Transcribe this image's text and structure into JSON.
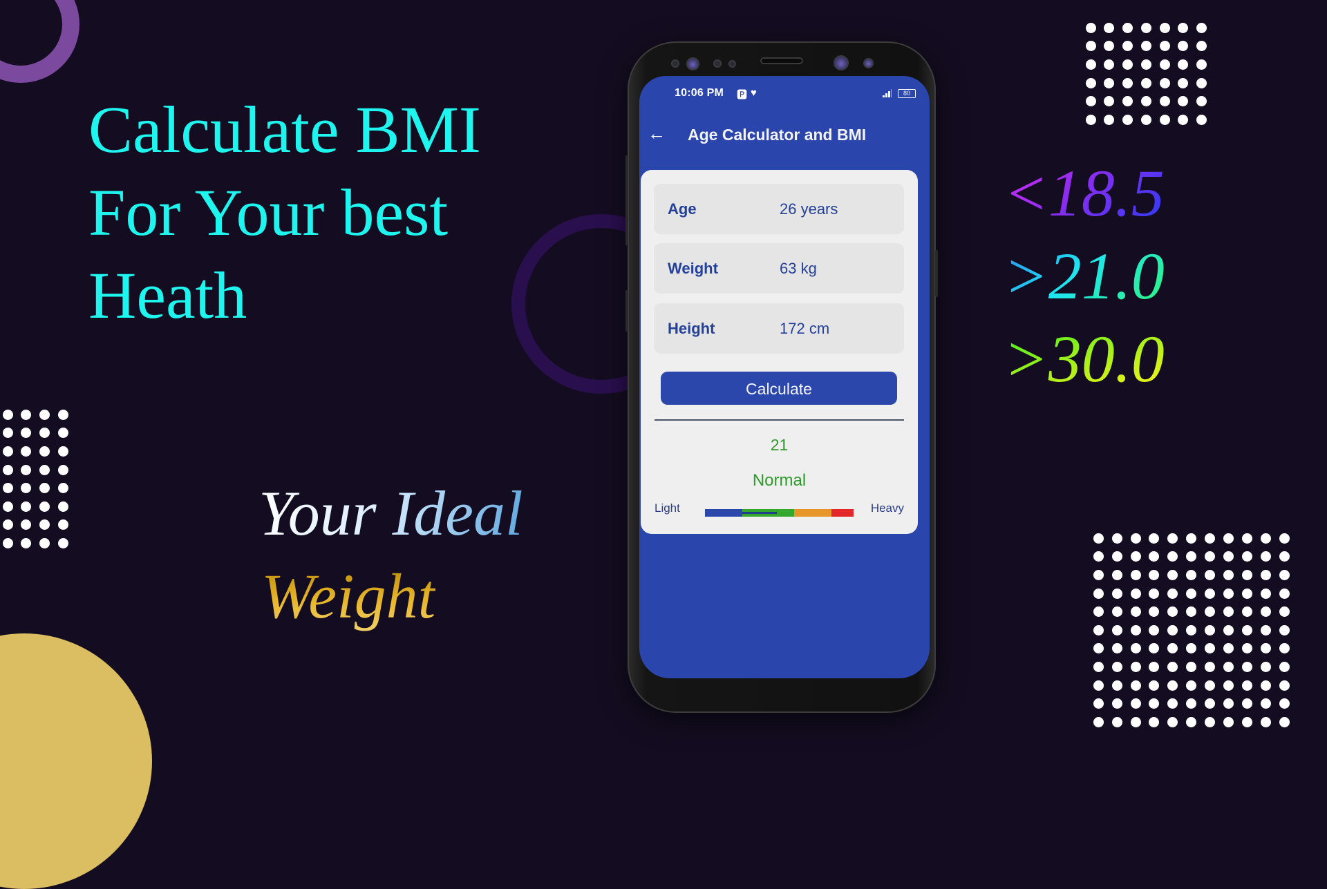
{
  "promo": {
    "headline": [
      "Calculate BMI",
      "For Your best",
      "Heath"
    ],
    "tagline_line1": "Your Ideal",
    "tagline_line2": "Weight",
    "bmi_ranges": [
      "<18.5",
      ">21.0",
      ">30.0"
    ]
  },
  "colors": {
    "background": "#140d21",
    "headline": "#1ff5ef",
    "app_primary": "#2a45ab",
    "result_green": "#2e9a2a",
    "accent_ring": "#7b4a9e",
    "accent_sun": "#dbbd62"
  },
  "phone": {
    "status_bar": {
      "time": "10:06 PM",
      "notification_icons": [
        "parking-app-icon",
        "heart-rate-icon"
      ],
      "battery_level": "80"
    },
    "app_bar": {
      "back_icon": "arrow-left-icon",
      "title": "Age Calculator and BMI"
    },
    "fields": [
      {
        "label": "Age",
        "value": "26 years"
      },
      {
        "label": "Weight",
        "value": "63 kg"
      },
      {
        "label": "Height",
        "value": "172 cm"
      }
    ],
    "calculate_label": "Calculate",
    "result": {
      "bmi": "21",
      "category": "Normal",
      "scale_min_label": "Light",
      "scale_max_label": "Heavy",
      "scale_segments": [
        {
          "name": "underweight",
          "color": "#2b47ab",
          "share": 0.25
        },
        {
          "name": "normal",
          "color": "#34a82e",
          "share": 0.35
        },
        {
          "name": "overweight",
          "color": "#e8952a",
          "share": 0.25
        },
        {
          "name": "obese",
          "color": "#e3262a",
          "share": 0.15
        }
      ],
      "indicator_fill_within_normal": 0.67
    }
  }
}
